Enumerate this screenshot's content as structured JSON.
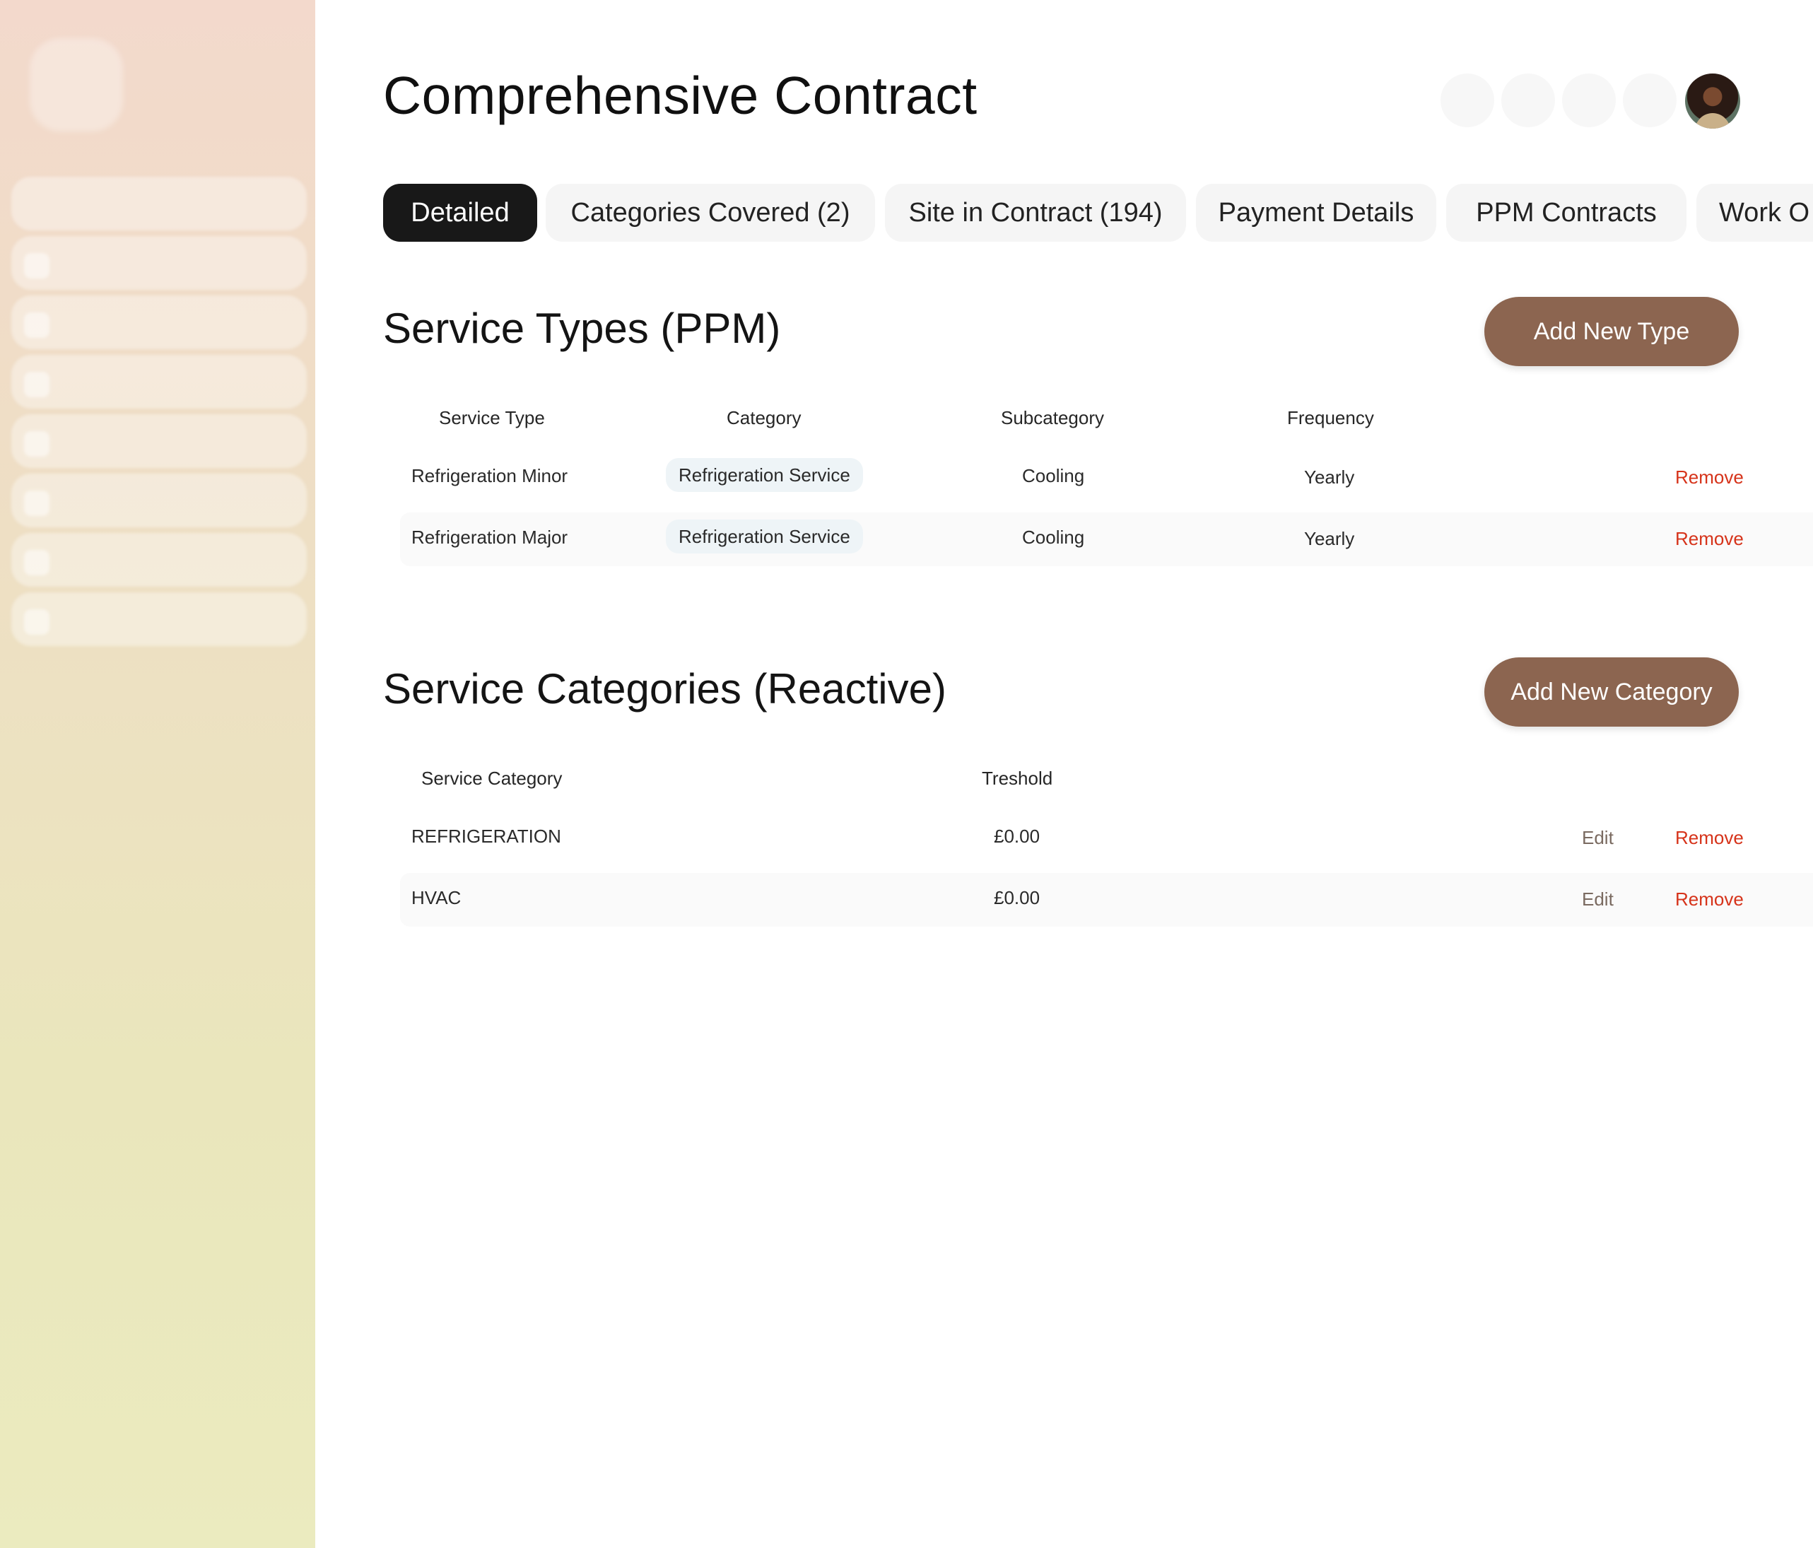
{
  "page": {
    "title": "Comprehensive Contract"
  },
  "tabs": [
    {
      "label": "Detailed",
      "active": true
    },
    {
      "label": "Categories Covered (2)",
      "active": false
    },
    {
      "label": "Site in Contract (194)",
      "active": false
    },
    {
      "label": "Payment Details",
      "active": false
    },
    {
      "label": "PPM Contracts",
      "active": false
    },
    {
      "label": "Work O",
      "active": false
    }
  ],
  "service_types": {
    "title": "Service Types (PPM)",
    "add_label": "Add New Type",
    "columns": [
      "Service Type",
      "Category",
      "Subcategory",
      "Frequency"
    ],
    "rows": [
      {
        "service_type": "Refrigeration Minor",
        "category": "Refrigeration Service",
        "subcategory": "Cooling",
        "frequency": "Yearly",
        "remove": "Remove"
      },
      {
        "service_type": "Refrigeration Major",
        "category": "Refrigeration Service",
        "subcategory": "Cooling",
        "frequency": "Yearly",
        "remove": "Remove"
      }
    ]
  },
  "service_categories": {
    "title": "Service Categories (Reactive)",
    "add_label": "Add New Category",
    "columns": [
      "Service Category",
      "Treshold"
    ],
    "rows": [
      {
        "category": "REFRIGERATION",
        "threshold": "£0.00",
        "edit": "Edit",
        "remove": "Remove"
      },
      {
        "category": "HVAC",
        "threshold": "£0.00",
        "edit": "Edit",
        "remove": "Remove"
      }
    ]
  },
  "colors": {
    "accent_brown": "#8c6550",
    "remove_red": "#d6331a",
    "active_tab": "#181818",
    "chip_bg": "#eef4f7"
  }
}
